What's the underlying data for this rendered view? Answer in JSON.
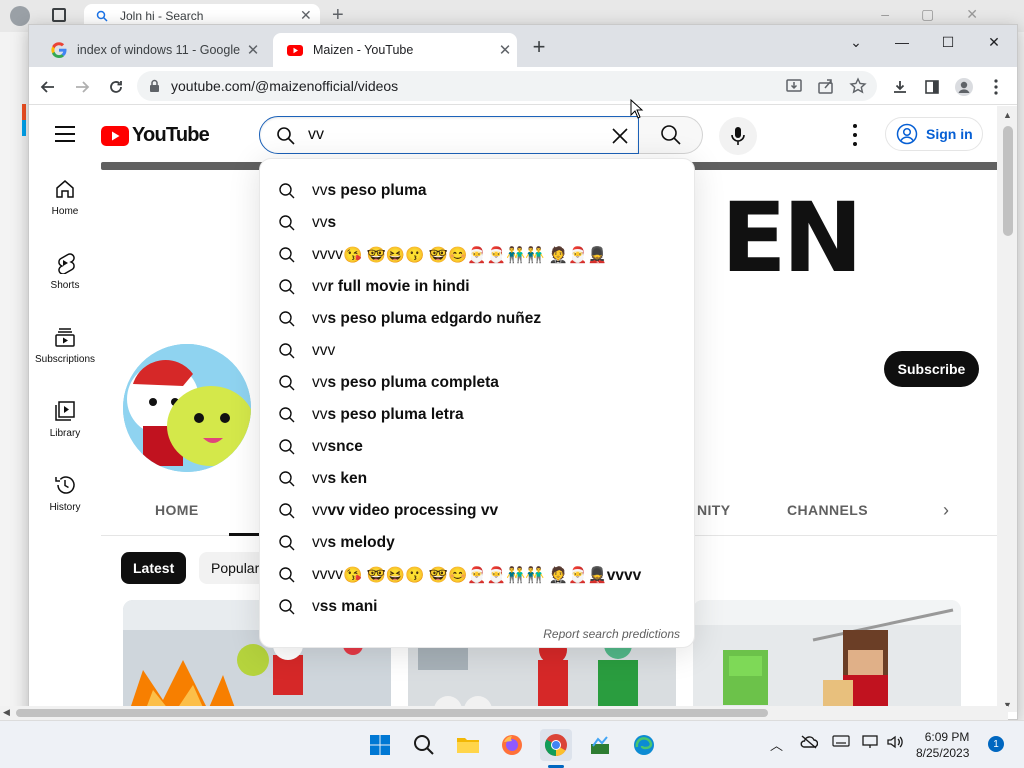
{
  "background_window": {
    "tab_label": "Joln hi - Search"
  },
  "browser": {
    "tabs": [
      {
        "label": "index of windows 11 - Google Se",
        "favicon": "google-icon"
      },
      {
        "label": "Maizen - YouTube",
        "favicon": "youtube-icon"
      }
    ],
    "url": "youtube.com/@maizenofficial/videos"
  },
  "youtube": {
    "logo_text": "YouTube",
    "search": {
      "value": "vv",
      "typed_prefix": "vv"
    },
    "sign_in_label": "Sign in",
    "guide": [
      {
        "label": "Home",
        "icon": "home-icon"
      },
      {
        "label": "Shorts",
        "icon": "shorts-icon"
      },
      {
        "label": "Subscriptions",
        "icon": "subscriptions-icon"
      },
      {
        "label": "Library",
        "icon": "library-icon"
      },
      {
        "label": "History",
        "icon": "history-icon"
      }
    ],
    "suggestions": [
      {
        "prefix": "vv",
        "rest": "s peso pluma"
      },
      {
        "prefix": "vv",
        "rest": "s"
      },
      {
        "prefix": "vvvv",
        "rest": "😘 🤓😆😗 🤓😊🎅🎅👬👬 🤵🎅💂"
      },
      {
        "prefix": "vv",
        "rest": "r full movie in hindi"
      },
      {
        "prefix": "vv",
        "rest": "s peso pluma edgardo nuñez"
      },
      {
        "prefix": "vvv",
        "rest": ""
      },
      {
        "prefix": "vv",
        "rest": "s peso pluma completa"
      },
      {
        "prefix": "vv",
        "rest": "s peso pluma letra"
      },
      {
        "prefix": "vv",
        "rest": "snce"
      },
      {
        "prefix": "vv",
        "rest": "s ken"
      },
      {
        "prefix": "vv",
        "rest": "vv video processing vv"
      },
      {
        "prefix": "vv",
        "rest": "s melody"
      },
      {
        "prefix": "vvvv",
        "rest": "😘 🤓😆😗 🤓😊🎅🎅👬👬 🤵🎅💂vvvv"
      },
      {
        "prefix": "v",
        "rest": "ss mani"
      }
    ],
    "report_label": "Report search predictions",
    "banner_text": "EN",
    "subscribe_label": "Subscribe",
    "channel_tabs": [
      "HOME",
      "NITY",
      "CHANNELS"
    ],
    "chips": [
      "Latest",
      "Popular"
    ]
  },
  "taskbar": {
    "time": "6:09 PM",
    "date": "8/25/2023",
    "notification_count": "1"
  },
  "colors": {
    "youtube_red": "#ff0000",
    "accent_blue": "#065fd4",
    "windows_blue": "#0067c0"
  }
}
